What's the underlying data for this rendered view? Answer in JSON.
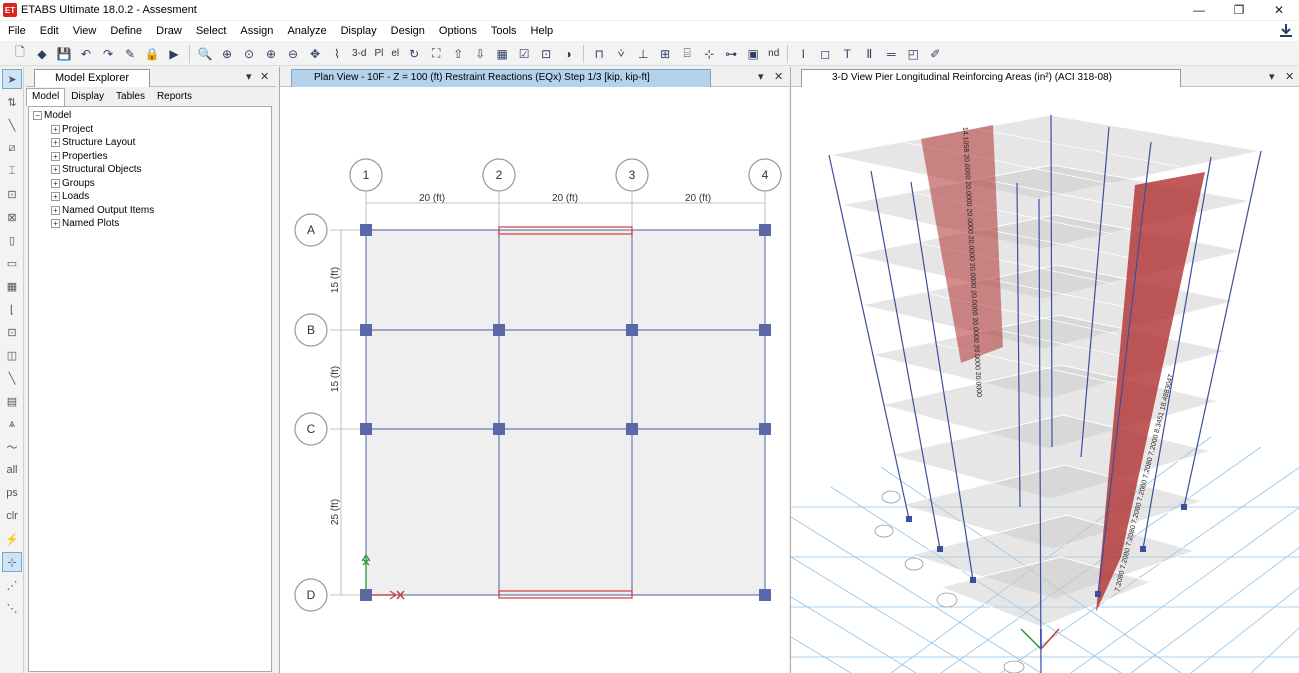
{
  "window": {
    "app_icon_text": "ET",
    "title": "ETABS Ultimate 18.0.2 - Assesment",
    "controls": [
      "minimize-icon",
      "restore-icon",
      "close-icon"
    ]
  },
  "menu": [
    "File",
    "Edit",
    "View",
    "Define",
    "Draw",
    "Select",
    "Assign",
    "Analyze",
    "Display",
    "Design",
    "Options",
    "Tools",
    "Help"
  ],
  "toolbar": {
    "label_3d": "3-d",
    "label_plan": "Pl",
    "label_elev": "el",
    "label_nd": "nd"
  },
  "explorer": {
    "title": "Model Explorer",
    "tabs": [
      "Model",
      "Display",
      "Tables",
      "Reports"
    ],
    "root": "Model",
    "items": [
      "Project",
      "Structure Layout",
      "Properties",
      "Structural Objects",
      "Groups",
      "Loads",
      "Named Output Items",
      "Named Plots"
    ]
  },
  "plan_view": {
    "tab_title": "Plan View - 10F - Z = 100 (ft)    Restraint Reactions    (EQx)  Step 1/3  [kip, kip-ft]",
    "grid_columns": [
      "1",
      "2",
      "3",
      "4"
    ],
    "grid_rows": [
      "A",
      "B",
      "C",
      "D"
    ],
    "x_spacings": [
      "20 (ft)",
      "20 (ft)",
      "20 (ft)"
    ],
    "y_spacings": [
      "15 (ft)",
      "15 (ft)",
      "25 (ft)"
    ]
  },
  "view_3d": {
    "tab_title": "3-D View  Pier Longitudinal Reinforcing Areas (in²)  (ACI 318-08)",
    "pier_left_label": "14.1058 20.0000 20.0000 20.0000 20.0000 20.0000 20.0000 20.0000 20.0000 20.0000",
    "pier_right_label": "7.2080 7.2080 7.2080 7.2080 7.2080 7.2080 7.2000 8.3451  18.4883047"
  },
  "colors": {
    "accent": "#3c4f9e",
    "pier_red": "#b03030",
    "tab_active": "#b5d2ec"
  }
}
